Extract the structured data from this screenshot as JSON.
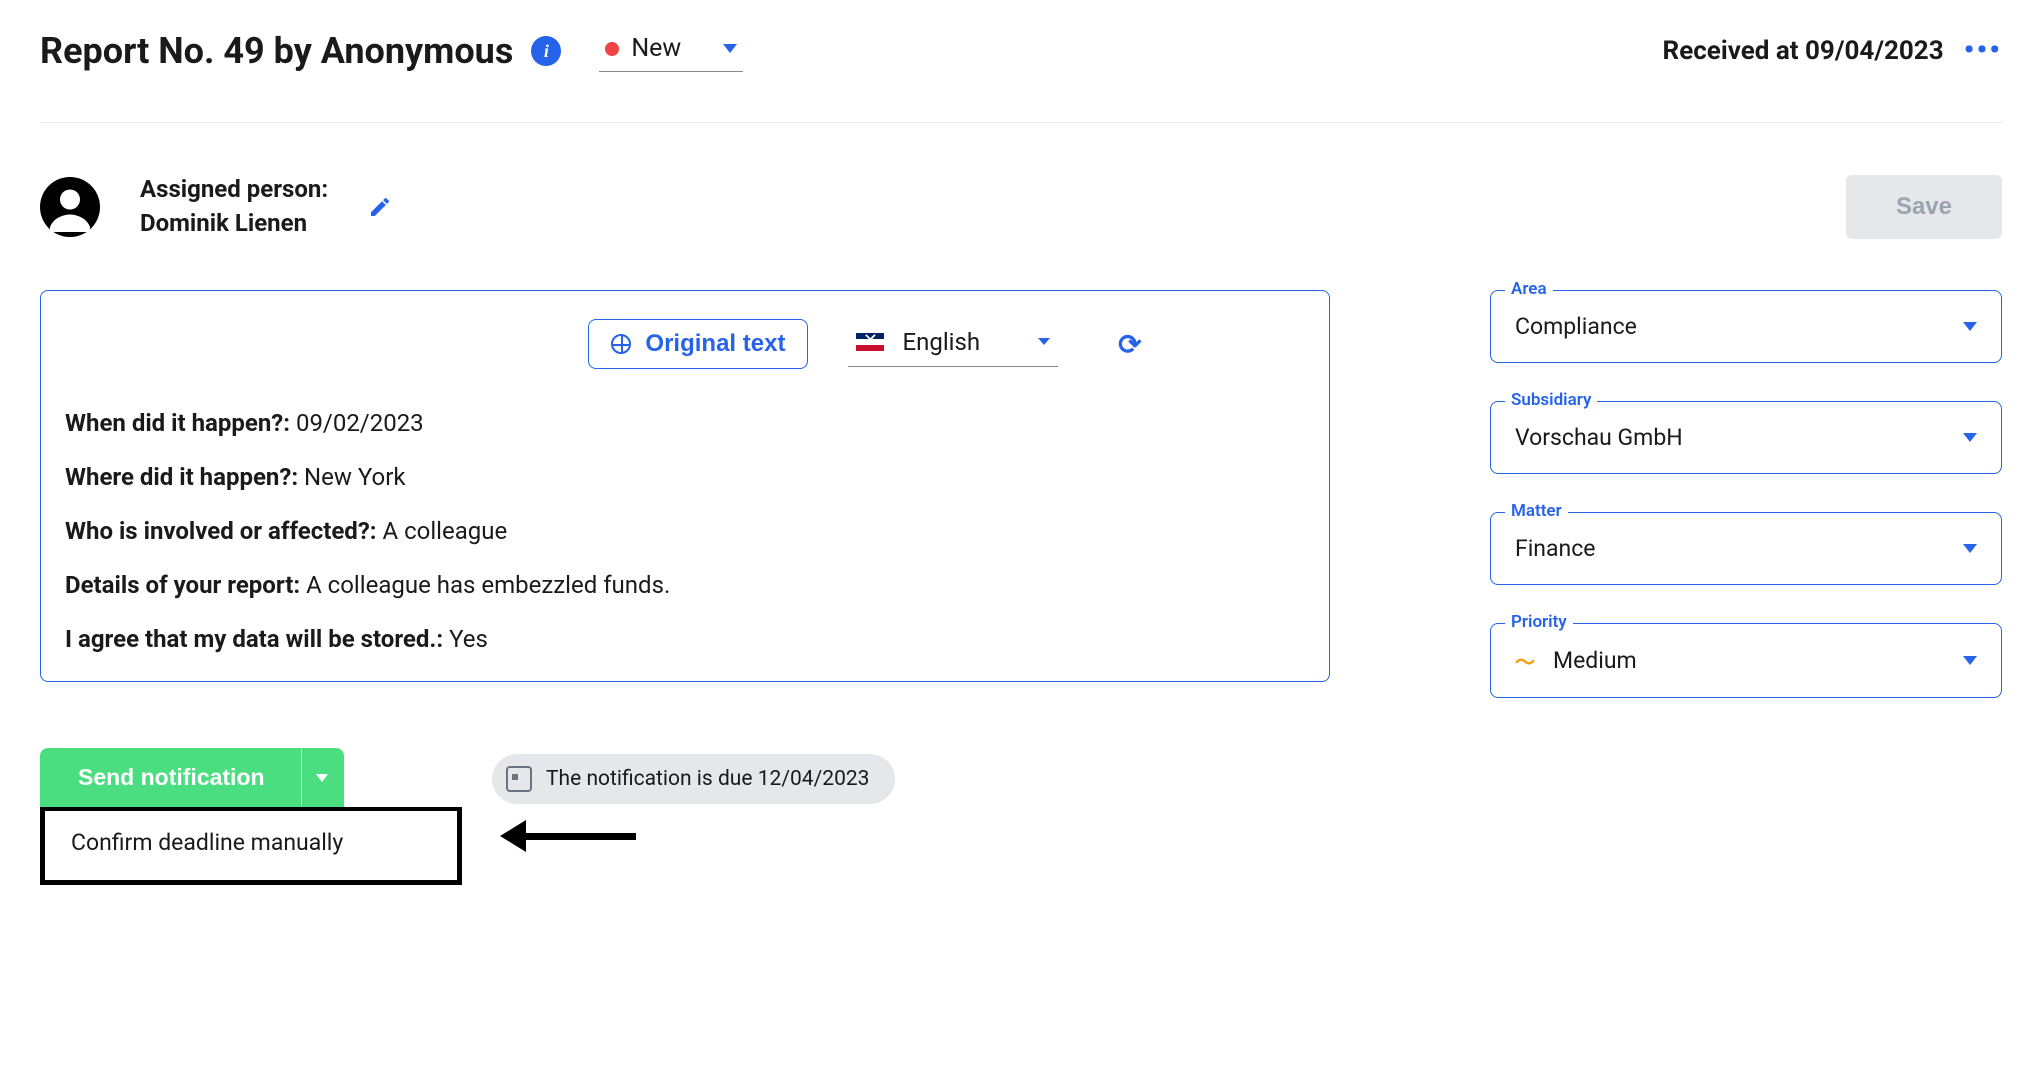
{
  "header": {
    "title": "Report No. 49 by Anonymous",
    "status": "New",
    "received_label": "Received at 09/04/2023"
  },
  "assigned": {
    "label": "Assigned person:",
    "name": "Dominik Lienen"
  },
  "save_label": "Save",
  "toolbar": {
    "original_text_label": "Original text",
    "language": "English"
  },
  "report": {
    "q1_label": "When did it happen?:",
    "q1_value": "09/02/2023",
    "q2_label": "Where did it happen?:",
    "q2_value": "New York",
    "q3_label": "Who is involved or affected?:",
    "q3_value": "A colleague",
    "q4_label": "Details of your report:",
    "q4_value": "A colleague has embezzled funds.",
    "q5_label": "I agree that my data will be stored.:",
    "q5_value": "Yes"
  },
  "side": {
    "area_label": "Area",
    "area_value": "Compliance",
    "subsidiary_label": "Subsidiary",
    "subsidiary_value": "Vorschau GmbH",
    "matter_label": "Matter",
    "matter_value": "Finance",
    "priority_label": "Priority",
    "priority_value": "Medium"
  },
  "actions": {
    "send_label": "Send notification",
    "confirm_label": "Confirm deadline manually",
    "due_text": "The notification is due 12/04/2023"
  }
}
